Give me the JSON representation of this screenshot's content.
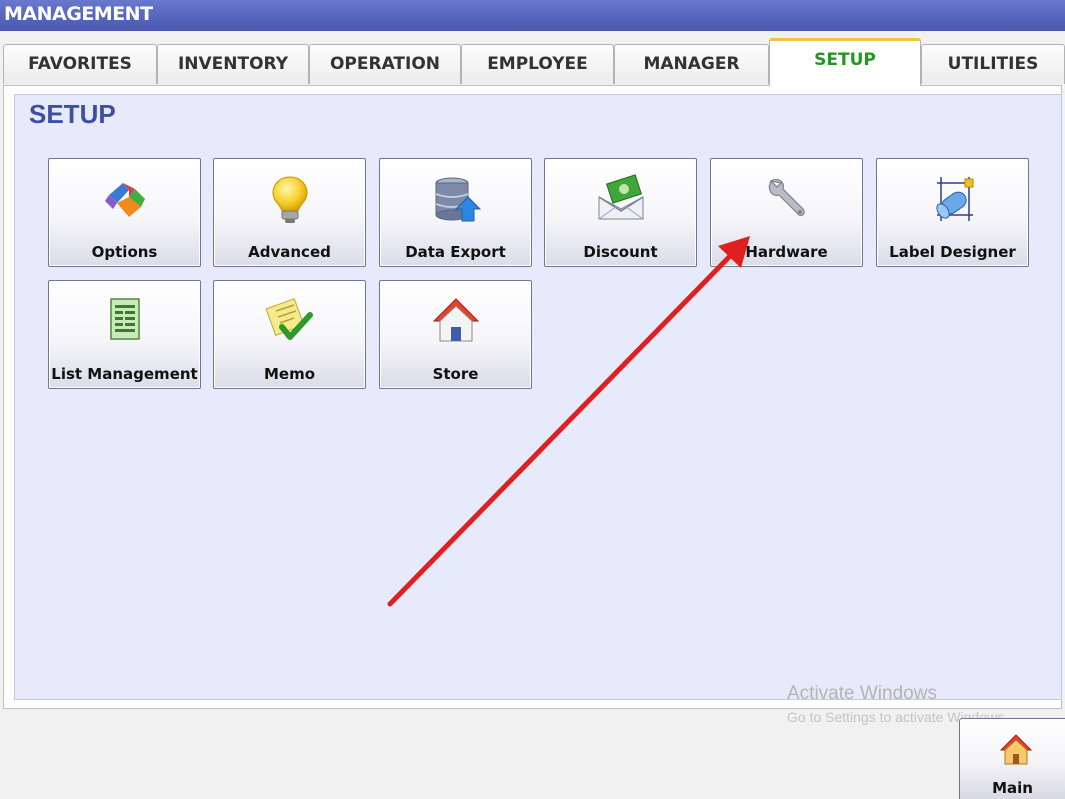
{
  "window": {
    "title": "MANAGEMENT"
  },
  "tabs": [
    {
      "label": "FAVORITES",
      "active": false
    },
    {
      "label": "INVENTORY",
      "active": false
    },
    {
      "label": "OPERATION",
      "active": false
    },
    {
      "label": "EMPLOYEE",
      "active": false
    },
    {
      "label": "MANAGER",
      "active": false
    },
    {
      "label": "SETUP",
      "active": true
    },
    {
      "label": "UTILITIES",
      "active": false
    }
  ],
  "section": {
    "title": "SETUP"
  },
  "tiles": [
    {
      "label": "Options",
      "icon": "options-icon"
    },
    {
      "label": "Advanced",
      "icon": "lightbulb-icon"
    },
    {
      "label": "Data Export",
      "icon": "database-export-icon"
    },
    {
      "label": "Discount",
      "icon": "money-envelope-icon"
    },
    {
      "label": "Hardware",
      "icon": "wrench-icon"
    },
    {
      "label": "Label Designer",
      "icon": "label-designer-icon"
    },
    {
      "label": "List Management",
      "icon": "list-document-icon"
    },
    {
      "label": "Memo",
      "icon": "memo-check-icon"
    },
    {
      "label": "Store",
      "icon": "house-icon"
    }
  ],
  "watermark": {
    "line1": "Activate Windows",
    "line2": "Go to Settings to activate Windows."
  },
  "footer": {
    "main_label": "Main",
    "main_icon": "house-icon"
  },
  "colors": {
    "active_tab_text": "#25961f",
    "active_tab_accent": "#f0c247",
    "title_bar": "#5665be",
    "section_title": "#3d4fa4",
    "arrow": "#e02020"
  }
}
